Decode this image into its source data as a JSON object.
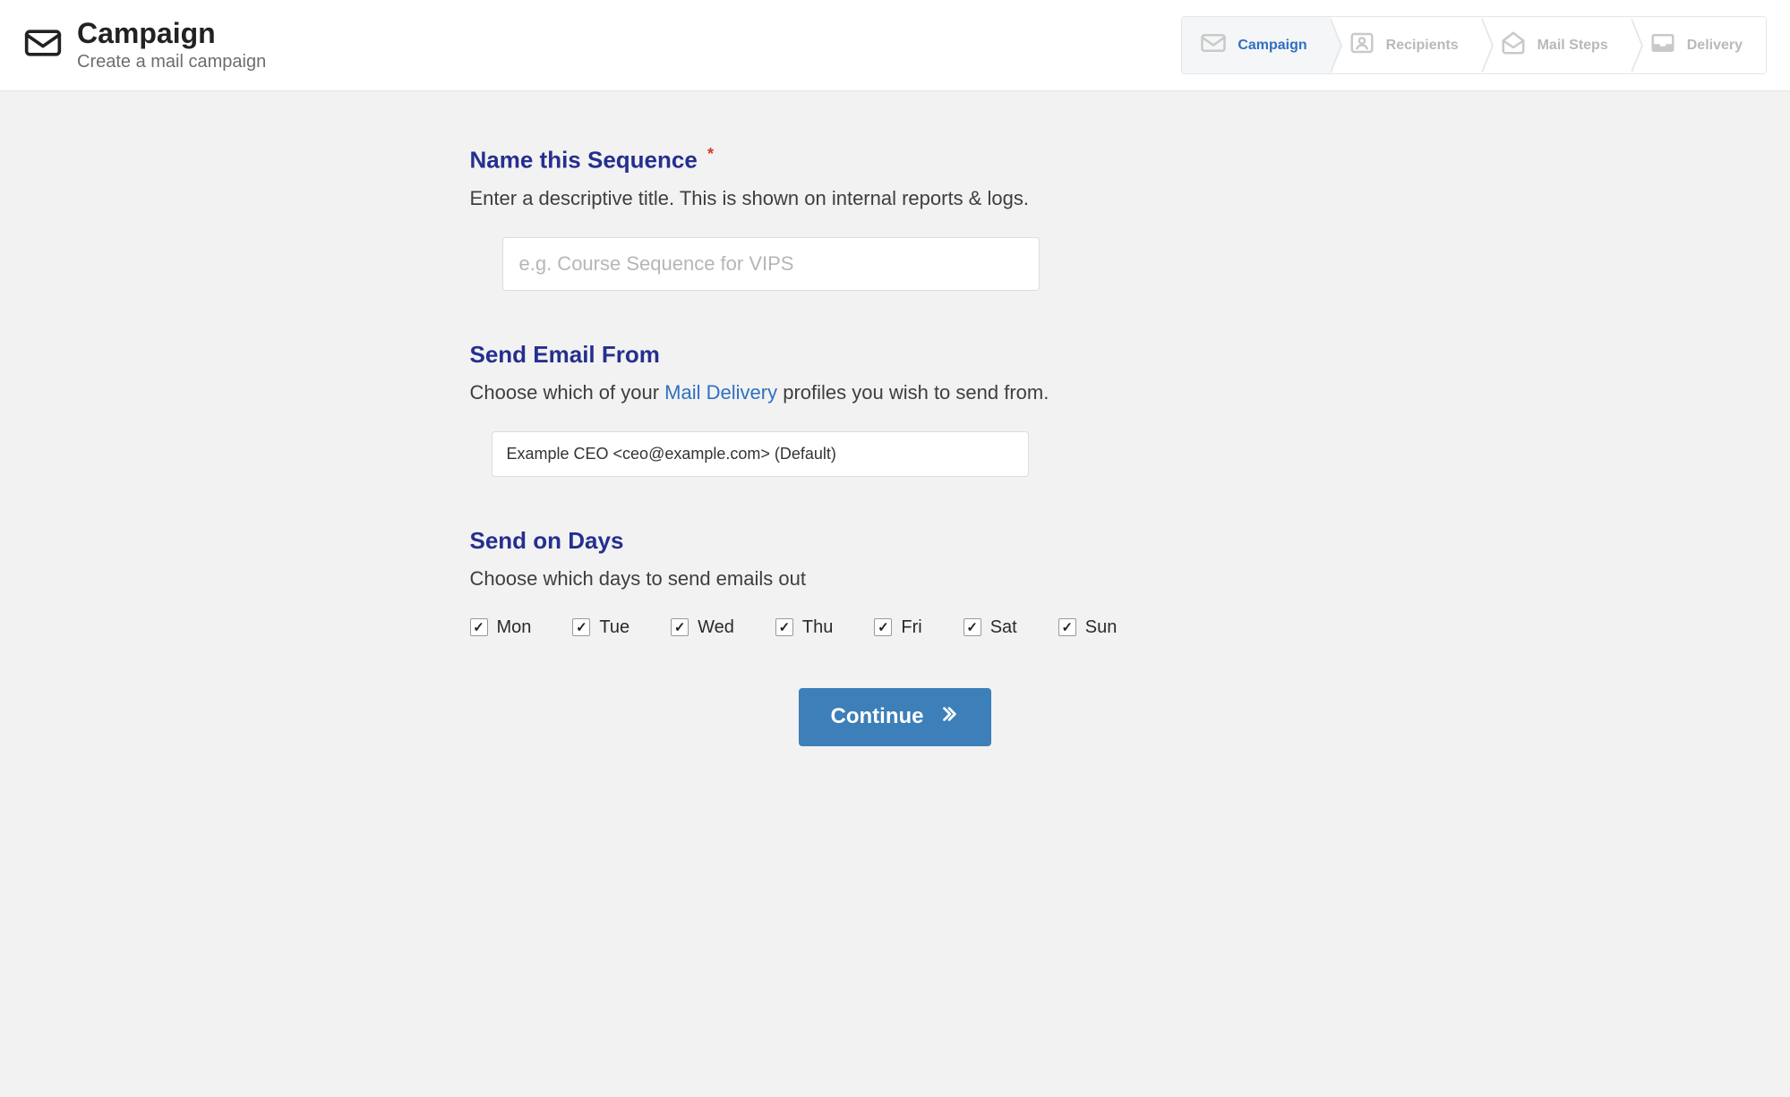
{
  "header": {
    "title": "Campaign",
    "subtitle": "Create a mail campaign"
  },
  "wizard": {
    "steps": [
      {
        "label": "Campaign",
        "active": true
      },
      {
        "label": "Recipients",
        "active": false
      },
      {
        "label": "Mail Steps",
        "active": false
      },
      {
        "label": "Delivery",
        "active": false
      }
    ]
  },
  "form": {
    "name_section": {
      "title": "Name this Sequence",
      "required_mark": "*",
      "help": "Enter a descriptive title. This is shown on internal reports & logs.",
      "placeholder": "e.g. Course Sequence for VIPS",
      "value": ""
    },
    "from_section": {
      "title": "Send Email From",
      "help_prefix": "Choose which of your ",
      "help_link_text": "Mail Delivery",
      "help_suffix": " profiles you wish to send from.",
      "selected": "Example CEO <ceo@example.com> (Default)"
    },
    "days_section": {
      "title": "Send on Days",
      "help": "Choose which days to send emails out",
      "days": [
        {
          "label": "Mon",
          "checked": true
        },
        {
          "label": "Tue",
          "checked": true
        },
        {
          "label": "Wed",
          "checked": true
        },
        {
          "label": "Thu",
          "checked": true
        },
        {
          "label": "Fri",
          "checked": true
        },
        {
          "label": "Sat",
          "checked": true
        },
        {
          "label": "Sun",
          "checked": true
        }
      ]
    },
    "continue_label": "Continue"
  }
}
